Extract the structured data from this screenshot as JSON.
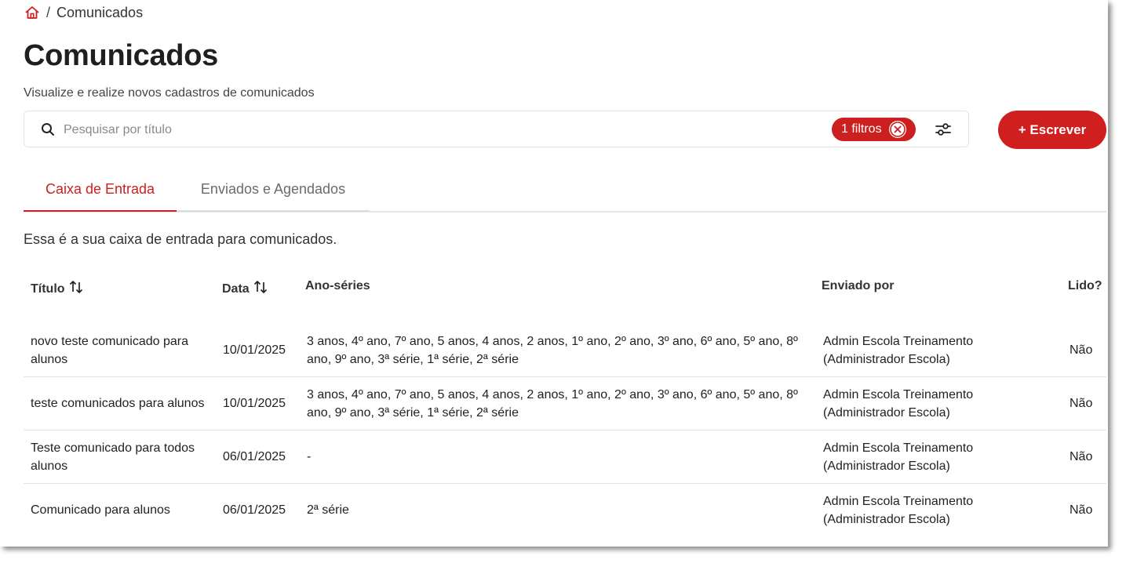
{
  "breadcrumb": {
    "current": "Comunicados",
    "separator": "/"
  },
  "header": {
    "title": "Comunicados",
    "subtitle": "Visualize e realize novos cadastros de comunicados"
  },
  "search": {
    "placeholder": "Pesquisar por título",
    "value": "",
    "filter_chip_label": "1 filtros"
  },
  "write_button": {
    "label": "+ Escrever"
  },
  "tabs": [
    {
      "label": "Caixa de Entrada",
      "active": true
    },
    {
      "label": "Enviados e Agendados",
      "active": false
    }
  ],
  "inbox_note": "Essa é a sua caixa de entrada para comunicados.",
  "table": {
    "columns": {
      "title": "Título",
      "date": "Data",
      "series": "Ano-séries",
      "sent_by": "Enviado por",
      "read": "Lido?"
    },
    "rows": [
      {
        "title": "novo teste comunicado para alunos",
        "date": "10/01/2025",
        "series": "3 anos, 4º ano, 7º ano, 5 anos, 4 anos, 2 anos, 1º ano, 2º ano, 3º ano, 6º ano, 5º ano, 8º ano, 9º ano, 3ª série, 1ª série, 2ª série",
        "sent_by": "Admin Escola Treinamento (Administrador Escola)",
        "read": "Não"
      },
      {
        "title": "teste comunicados para alunos",
        "date": "10/01/2025",
        "series": "3 anos, 4º ano, 7º ano, 5 anos, 4 anos, 2 anos, 1º ano, 2º ano, 3º ano, 6º ano, 5º ano, 8º ano, 9º ano, 3ª série, 1ª série, 2ª série",
        "sent_by": "Admin Escola Treinamento (Administrador Escola)",
        "read": "Não"
      },
      {
        "title": "Teste comunicado para todos alunos",
        "date": "06/01/2025",
        "series": "-",
        "sent_by": "Admin Escola Treinamento (Administrador Escola)",
        "read": "Não"
      },
      {
        "title": "Comunicado para alunos",
        "date": "06/01/2025",
        "series": "2ª série",
        "sent_by": "Admin Escola Treinamento (Administrador Escola)",
        "read": "Não"
      }
    ]
  },
  "colors": {
    "accent": "#cc1f1f",
    "text": "#1f1f1f",
    "muted": "#6b6b6b",
    "divider": "#e4e4e4"
  },
  "icons": [
    "home-icon",
    "search-icon",
    "close-icon",
    "filter-settings-icon",
    "sort-icon"
  ]
}
